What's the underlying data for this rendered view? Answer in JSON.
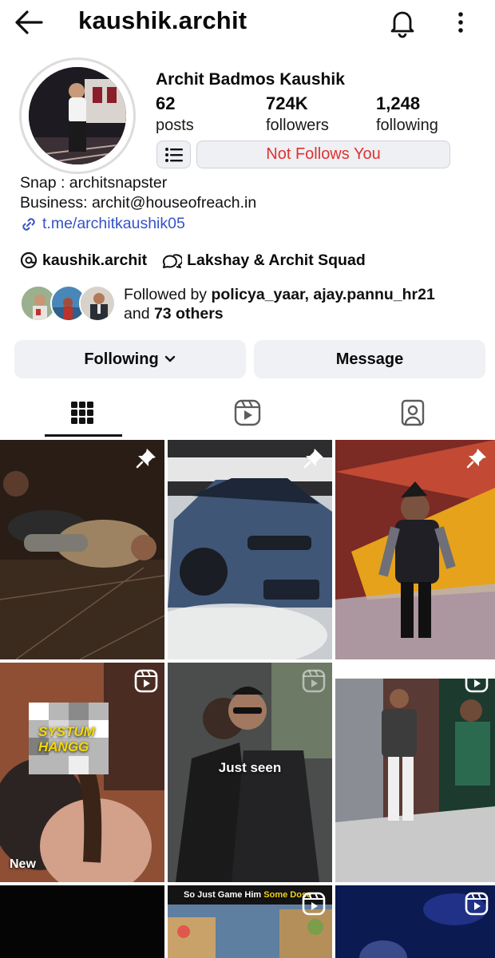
{
  "header": {
    "username": "kaushik.archit"
  },
  "profile": {
    "full_name": "Archit Badmos Kaushik",
    "stats": [
      {
        "value": "62",
        "label": "posts"
      },
      {
        "value": "724K",
        "label": "followers"
      },
      {
        "value": "1,248",
        "label": "following"
      }
    ],
    "relation_label": "Not Follows You",
    "bio": {
      "line1": "Snap : architsnapster",
      "line2": "Business: archit@houseofreach.in",
      "link": "t.me/architkaushik05"
    },
    "threads_chip": "kaushik.archit",
    "community_chip": "Lakshay & Archit Squad",
    "mutual": {
      "prefix": "Followed by ",
      "names": "policya_yaar, ajay.pannu_hr21",
      "and_text": "and ",
      "others": "73 others"
    }
  },
  "actions": {
    "following_label": "Following",
    "message_label": "Message"
  },
  "tabs": [
    {
      "icon": "grid-icon",
      "active": true
    },
    {
      "icon": "reels-icon",
      "active": false
    },
    {
      "icon": "tagged-icon",
      "active": false
    }
  ],
  "grid": {
    "tile4_sticker_line1": "SYSTUM",
    "tile4_sticker_line2": "HANGG",
    "tile4_label": "New",
    "tile5_label": "Just seen",
    "tile8_caption_a": "So Just Game Him ",
    "tile8_caption_b": "Some Dose"
  },
  "colors": {
    "accent_red": "#e03131",
    "link_blue": "#3552c7",
    "button_bg": "#eff1f4"
  }
}
